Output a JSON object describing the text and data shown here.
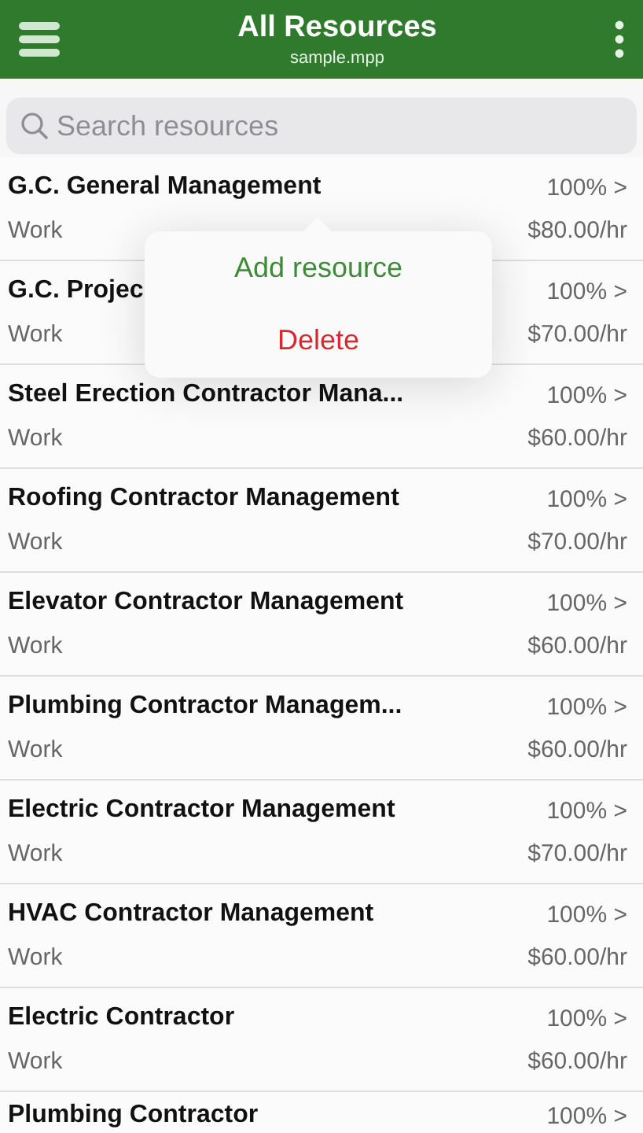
{
  "header": {
    "title": "All Resources",
    "subtitle": "sample.mpp"
  },
  "search": {
    "placeholder": "Search resources"
  },
  "resources": [
    {
      "name": "G.C. General Management",
      "units": "100% >",
      "type": "Work",
      "rate": "$80.00/hr"
    },
    {
      "name": "G.C. Projec",
      "units": "100% >",
      "type": "Work",
      "rate": "$70.00/hr"
    },
    {
      "name": "Steel Erection Contractor Mana...",
      "units": "100% >",
      "type": "Work",
      "rate": "$60.00/hr"
    },
    {
      "name": "Roofing Contractor Management",
      "units": "100% >",
      "type": "Work",
      "rate": "$70.00/hr"
    },
    {
      "name": "Elevator Contractor Management",
      "units": "100% >",
      "type": "Work",
      "rate": "$60.00/hr"
    },
    {
      "name": "Plumbing Contractor Managem...",
      "units": "100% >",
      "type": "Work",
      "rate": "$60.00/hr"
    },
    {
      "name": "Electric Contractor Management",
      "units": "100% >",
      "type": "Work",
      "rate": "$70.00/hr"
    },
    {
      "name": "HVAC Contractor Management",
      "units": "100% >",
      "type": "Work",
      "rate": "$60.00/hr"
    },
    {
      "name": "Electric Contractor",
      "units": "100% >",
      "type": "Work",
      "rate": "$60.00/hr"
    },
    {
      "name": "Plumbing Contractor",
      "units": "100% >"
    }
  ],
  "popup_menu": [
    {
      "label": "Add resource",
      "kind": "normal"
    },
    {
      "label": "Delete",
      "kind": "destructive"
    }
  ]
}
